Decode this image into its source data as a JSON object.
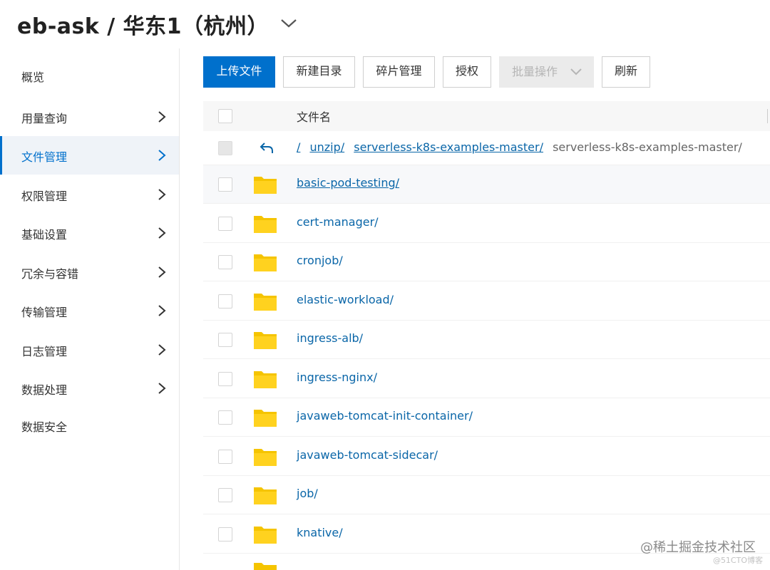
{
  "header": {
    "title": "eb-ask / 华东1（杭州）",
    "chevron_icon": "chevron-down-icon"
  },
  "sidebar": {
    "items": [
      {
        "label": "概览",
        "has_chevron": false,
        "active": false
      },
      {
        "label": "用量查询",
        "has_chevron": true,
        "active": false
      },
      {
        "label": "文件管理",
        "has_chevron": true,
        "active": true
      },
      {
        "label": "权限管理",
        "has_chevron": true,
        "active": false
      },
      {
        "label": "基础设置",
        "has_chevron": true,
        "active": false
      },
      {
        "label": "冗余与容错",
        "has_chevron": true,
        "active": false
      },
      {
        "label": "传输管理",
        "has_chevron": true,
        "active": false
      },
      {
        "label": "日志管理",
        "has_chevron": true,
        "active": false
      },
      {
        "label": "数据处理",
        "has_chevron": true,
        "active": false
      },
      {
        "label": "数据安全",
        "has_chevron": false,
        "active": false
      }
    ]
  },
  "toolbar": {
    "upload_label": "上传文件",
    "new_dir_label": "新建目录",
    "fragments_label": "碎片管理",
    "authorize_label": "授权",
    "batch_label": "批量操作",
    "refresh_label": "刷新"
  },
  "table": {
    "column_title": "文件名",
    "breadcrumbs": {
      "links": [
        "/",
        "unzip/",
        "serverless-k8s-examples-master/"
      ],
      "current": "serverless-k8s-examples-master/"
    },
    "rows": [
      {
        "name": "basic-pod-testing/"
      },
      {
        "name": "cert-manager/"
      },
      {
        "name": "cronjob/"
      },
      {
        "name": "elastic-workload/"
      },
      {
        "name": "ingress-alb/"
      },
      {
        "name": "ingress-nginx/"
      },
      {
        "name": "javaweb-tomcat-init-container/"
      },
      {
        "name": "javaweb-tomcat-sidecar/"
      },
      {
        "name": "job/"
      },
      {
        "name": "knative/"
      }
    ]
  },
  "colors": {
    "primary": "#0070cc",
    "link": "#0a66a8",
    "folder": "#f5c400"
  },
  "watermark": {
    "text": "@稀土掘金技术社区",
    "subtext": "@51CTO博客"
  }
}
